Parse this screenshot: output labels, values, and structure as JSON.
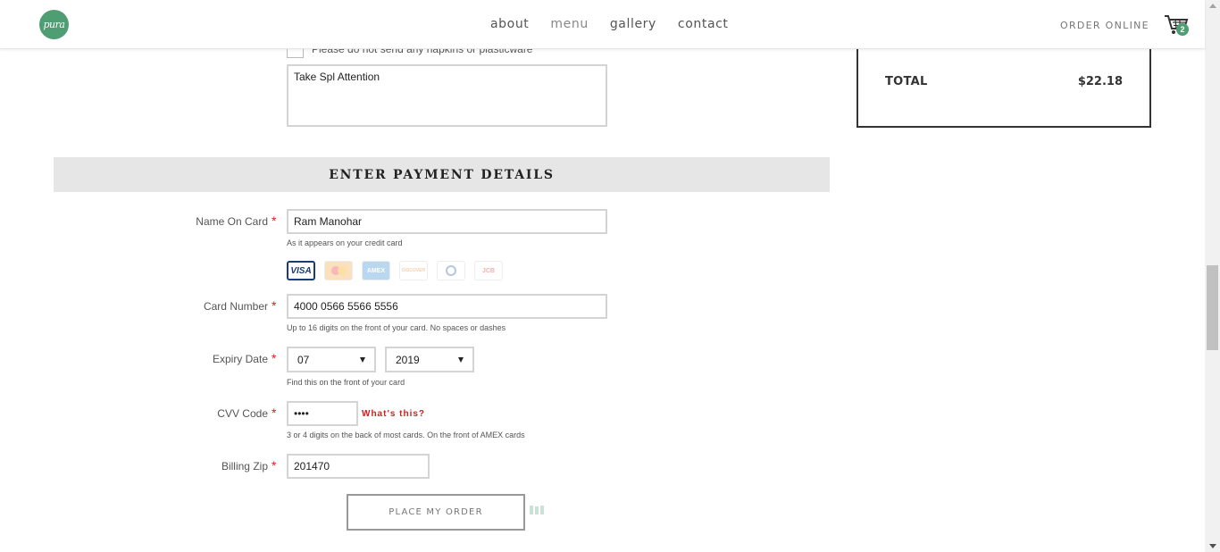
{
  "header": {
    "logo_text": "pura",
    "nav": [
      "about",
      "menu",
      "gallery",
      "contact"
    ],
    "order_online": "ORDER ONLINE",
    "cart_count": "2"
  },
  "summary": {
    "total_label": "TOTAL",
    "total_value": "$22.18"
  },
  "notes": {
    "napkin_label": "Please do not send any napkins or plasticware",
    "instructions_value": "Take Spl Attention"
  },
  "payment": {
    "section_title": "ENTER PAYMENT DETAILS",
    "name_label": "Name On Card",
    "name_value": "Ram Manohar",
    "name_help": "As it appears on your credit card",
    "cards": [
      "VISA",
      "MasterCard",
      "AMEX",
      "DISCOVER",
      "Diners",
      "JCB"
    ],
    "card_label": "Card Number",
    "card_value": "4000 0566 5566 5556",
    "card_help": "Up to 16 digits on the front of your card. No spaces or dashes",
    "expiry_label": "Expiry Date",
    "expiry_month": "07",
    "expiry_year": "2019",
    "expiry_help": "Find this on the front of your card",
    "cvv_label": "CVV Code",
    "cvv_value": "••••",
    "whats_this": "What's this?",
    "cvv_help": "3 or 4 digits on the back of most cards. On the front of AMEX cards",
    "zip_label": "Billing Zip",
    "zip_value": "201470",
    "required_mark": "*",
    "place_order": "PLACE MY ORDER"
  },
  "colors": {
    "brand_green": "#4f9d73",
    "required_red": "#d21e1e",
    "section_bg": "#e6e6e6"
  }
}
